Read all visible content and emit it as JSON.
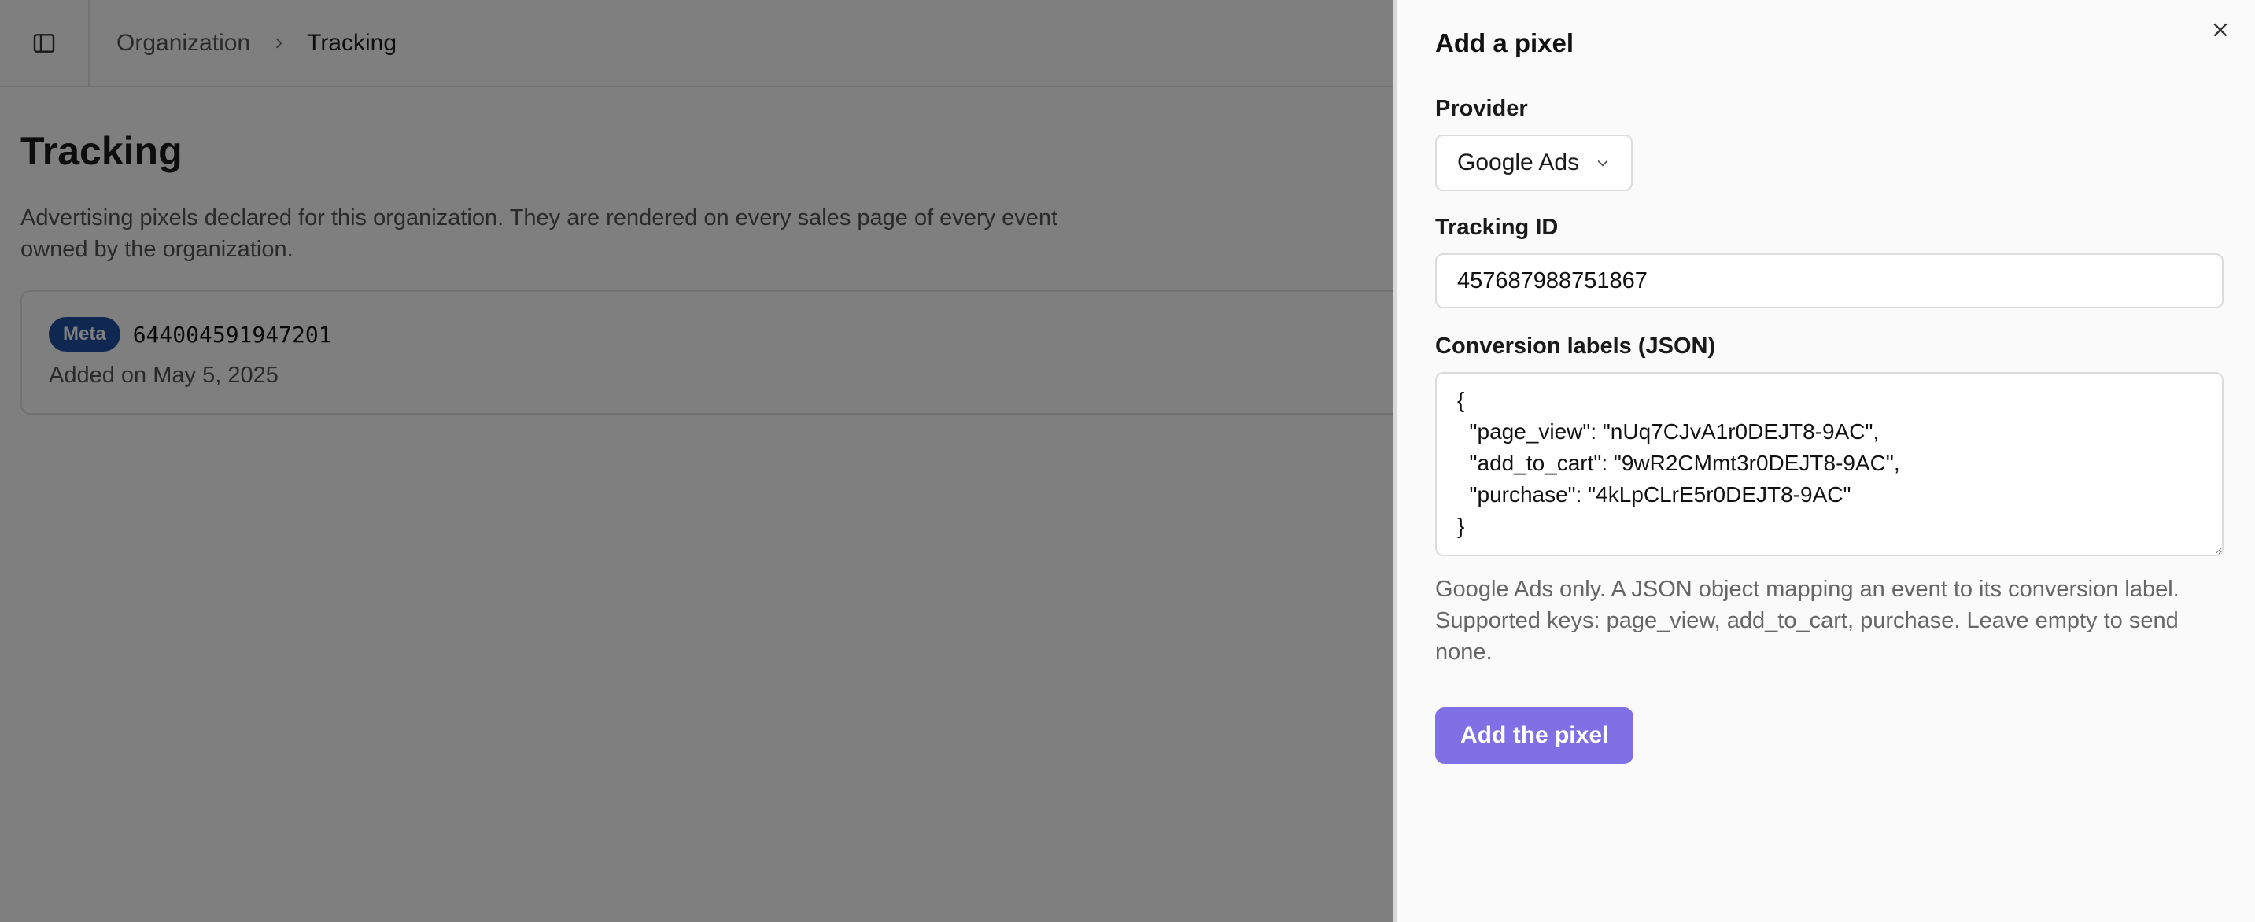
{
  "header": {
    "breadcrumb": {
      "parent": "Organization",
      "current": "Tracking"
    }
  },
  "main": {
    "title": "Tracking",
    "description": "Advertising pixels declared for this organization. They are rendered on every sales page of every event owned by the organization.",
    "pixels": [
      {
        "provider": "Meta",
        "id": "644004591947201",
        "added": "Added on May 5, 2025"
      }
    ]
  },
  "drawer": {
    "title": "Add a pixel",
    "provider_label": "Provider",
    "provider_value": "Google Ads",
    "tracking_label": "Tracking ID",
    "tracking_value": "457687988751867",
    "labels_label": "Conversion labels (JSON)",
    "labels_value": "{\n  \"page_view\": \"nUq7CJvA1r0DEJT8-9AC\",\n  \"add_to_cart\": \"9wR2CMmt3r0DEJT8-9AC\",\n  \"purchase\": \"4kLpCLrE5r0DEJT8-9AC\"\n}",
    "help_text": "Google Ads only. A JSON object mapping an event to its conversion label. Supported keys: page_view, add_to_cart, purchase. Leave empty to send none.",
    "submit_label": "Add the pixel"
  },
  "colors": {
    "badge": "#1f4fa3",
    "primary_button": "#7f70e6",
    "overlay": "rgba(0,0,0,0.5)"
  },
  "icons": [
    "sidebar-toggle-icon",
    "chevron-right-icon",
    "chevron-down-icon",
    "close-icon"
  ]
}
